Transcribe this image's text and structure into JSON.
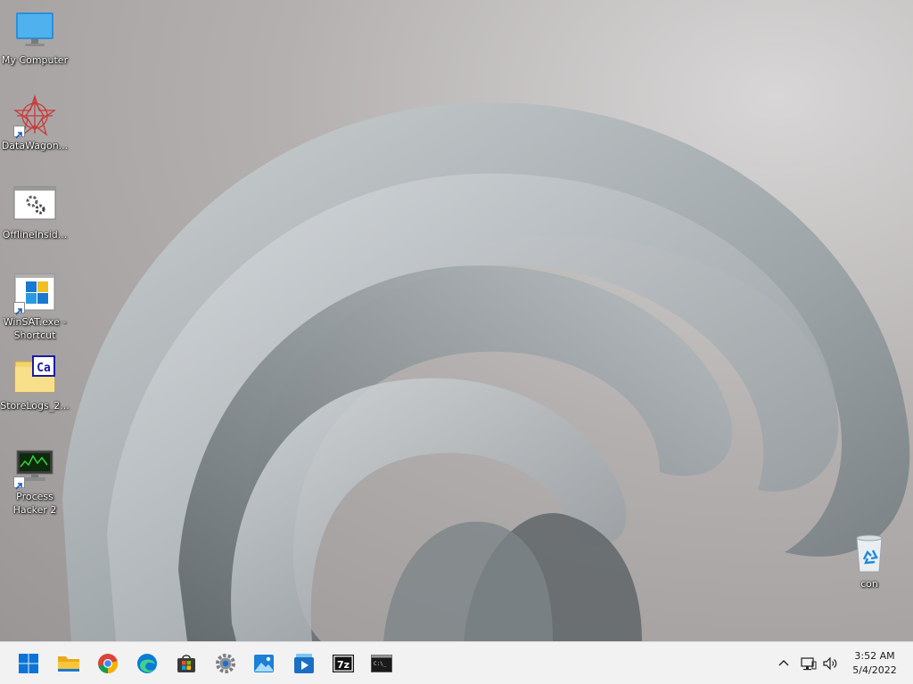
{
  "desktop": {
    "icons": [
      {
        "label": "My Computer",
        "icon": "monitor-icon"
      },
      {
        "label": "DataWagon...",
        "icon": "red-star-icon"
      },
      {
        "label": "OfflineInsid...",
        "icon": "gears-window-icon"
      },
      {
        "label": "WinSAT.exe - Shortcut",
        "icon": "winsat-icon"
      },
      {
        "label": "StoreLogs_2...",
        "icon": "folder-icon"
      },
      {
        "label": "Process Hacker 2",
        "icon": "process-monitor-icon"
      },
      {
        "label": "con",
        "icon": "recycle-bin-icon"
      }
    ]
  },
  "taskbar": {
    "apps": [
      {
        "icon": "windows-start-icon"
      },
      {
        "icon": "file-explorer-icon"
      },
      {
        "icon": "chrome-icon"
      },
      {
        "icon": "edge-icon"
      },
      {
        "icon": "store-icon"
      },
      {
        "icon": "settings-gear-icon"
      },
      {
        "icon": "photos-icon"
      },
      {
        "icon": "media-player-icon"
      },
      {
        "icon": "7zip-icon"
      },
      {
        "icon": "terminal-icon"
      }
    ],
    "tray": {
      "chevron_icon": "chevron-up-icon",
      "network_icon": "network-icon",
      "volume_icon": "volume-icon",
      "time": "3:52 AM",
      "date": "5/4/2022"
    },
    "labels": {
      "sevenzip": "7z",
      "terminal": "C:\\_"
    }
  },
  "colors": {
    "accent": "#0067c0",
    "taskbar_bg": "#f2f2f2",
    "folder": "#f5d36b"
  }
}
